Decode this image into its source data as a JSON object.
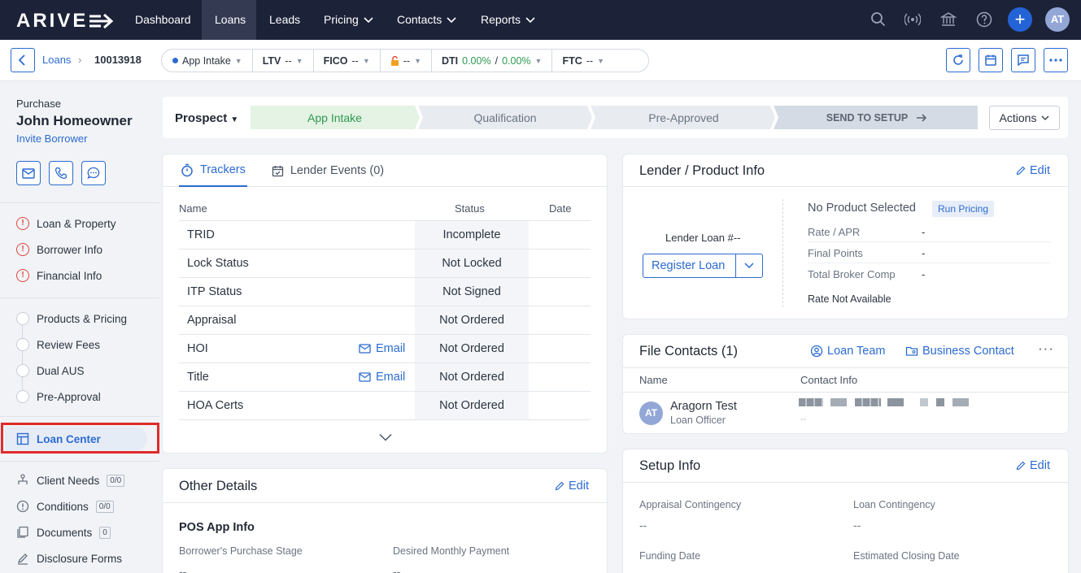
{
  "nav": {
    "logo": "ARIVE",
    "items": [
      "Dashboard",
      "Loans",
      "Leads",
      "Pricing",
      "Contacts",
      "Reports"
    ],
    "user_initials": "AT",
    "add_label": "+"
  },
  "subbar": {
    "breadcrumb_link": "Loans",
    "breadcrumb_sep": "›",
    "loan_id": "10013918",
    "stage_pill": "App Intake",
    "ltv_label": "LTV",
    "ltv_value": "--",
    "fico_label": "FICO",
    "fico_value": "--",
    "lock_value": "--",
    "dti_label": "DTI",
    "dti_front": "0.00%",
    "dti_sep": "/",
    "dti_back": "0.00%",
    "ftc_label": "FTC",
    "ftc_value": "--"
  },
  "sidebar": {
    "loan_type": "Purchase",
    "borrower_name": "John Homeowner",
    "invite_label": "Invite Borrower",
    "error_items": [
      "Loan & Property",
      "Borrower Info",
      "Financial Info"
    ],
    "step_items": [
      "Products & Pricing",
      "Review Fees",
      "Dual AUS",
      "Pre-Approval"
    ],
    "active_item": "Loan Center",
    "tool_items": [
      {
        "label": "Client Needs",
        "count": "0/0"
      },
      {
        "label": "Conditions",
        "count": "0/0"
      },
      {
        "label": "Documents",
        "count": "0"
      },
      {
        "label": "Disclosure Forms",
        "count": ""
      }
    ]
  },
  "progress": {
    "status": "Prospect",
    "stages": [
      "App Intake",
      "Qualification",
      "Pre-Approved"
    ],
    "send_label": "SEND TO SETUP",
    "actions_label": "Actions"
  },
  "trackers": {
    "tab_trackers": "Trackers",
    "tab_events": "Lender Events (0)",
    "col_name": "Name",
    "col_status": "Status",
    "col_date": "Date",
    "email_label": "Email",
    "rows": [
      {
        "name": "TRID",
        "status": "Incomplete"
      },
      {
        "name": "Lock Status",
        "status": "Not Locked"
      },
      {
        "name": "ITP Status",
        "status": "Not Signed"
      },
      {
        "name": "Appraisal",
        "status": "Not Ordered"
      },
      {
        "name": "HOI",
        "status": "Not Ordered"
      },
      {
        "name": "Title",
        "status": "Not Ordered"
      },
      {
        "name": "HOA Certs",
        "status": "Not Ordered"
      }
    ]
  },
  "lender": {
    "title": "Lender / Product Info",
    "edit_label": "Edit",
    "lender_loan": "Lender Loan #--",
    "register_label": "Register Loan",
    "no_product": "No Product Selected",
    "run_pricing": "Run Pricing",
    "rate_label": "Rate / APR",
    "rate_value": "-",
    "points_label": "Final Points",
    "points_value": "-",
    "comp_label": "Total Broker Comp",
    "comp_value": "-",
    "rate_na": "Rate Not Available"
  },
  "contacts": {
    "title": "File Contacts (1)",
    "loan_team": "Loan Team",
    "business_contact": "Business Contact",
    "more": "···",
    "col_name": "Name",
    "col_info": "Contact Info",
    "initials": "AT",
    "name": "Aragorn Test",
    "role": "Loan Officer",
    "info_sub": "--"
  },
  "other": {
    "title": "Other Details",
    "edit_label": "Edit",
    "section": "POS App Info",
    "field1_label": "Borrower's Purchase Stage",
    "field1_value": "--",
    "field2_label": "Desired Monthly Payment",
    "field2_value": "--"
  },
  "setup": {
    "title": "Setup Info",
    "edit_label": "Edit",
    "appraisal_label": "Appraisal Contingency",
    "appraisal_value": "--",
    "loan_cont_label": "Loan Contingency",
    "loan_cont_value": "--",
    "funding_label": "Funding Date",
    "closing_label": "Estimated Closing Date"
  }
}
